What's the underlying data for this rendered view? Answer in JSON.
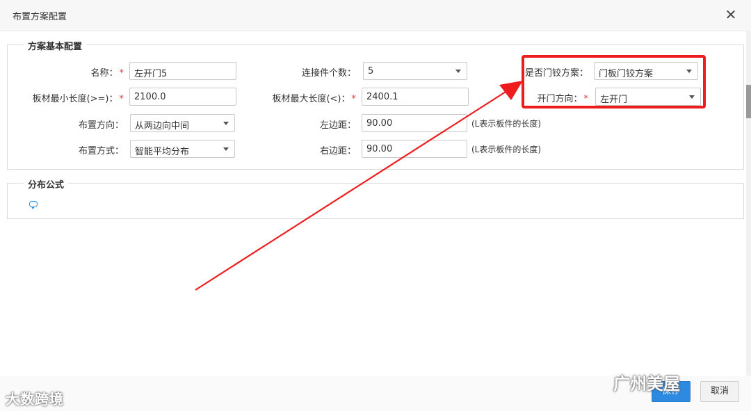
{
  "dialog": {
    "title": "布置方案配置",
    "close_glyph": "✕"
  },
  "basic": {
    "legend": "方案基本配置",
    "name": {
      "label": "名称：",
      "required": "*",
      "value": "左开门5"
    },
    "connector_count": {
      "label": "连接件个数：",
      "value": "5"
    },
    "is_hinge_plan": {
      "label": "是否门铰方案：",
      "value": "门板门铰方案"
    },
    "min_length": {
      "label": "板材最小长度(>=)：",
      "required": "*",
      "value": "2100.0"
    },
    "max_length": {
      "label": "板材最大长度(<)：",
      "required": "*",
      "value": "2400.1"
    },
    "door_direction": {
      "label": "开门方向：",
      "required": "*",
      "value": "左开门"
    },
    "layout_direction": {
      "label": "布置方向：",
      "value": "从两边向中间"
    },
    "left_margin": {
      "label": "左边距：",
      "value": "90.00",
      "hint": "(L表示板件的长度)"
    },
    "layout_method": {
      "label": "布置方式：",
      "value": "智能平均分布"
    },
    "right_margin": {
      "label": "右边距：",
      "value": "90.00",
      "hint": "(L表示板件的长度)"
    }
  },
  "formula": {
    "legend": "分布公式",
    "icon": "comment-icon"
  },
  "footer": {
    "save_label": "保存",
    "cancel_label": "取消"
  },
  "watermarks": {
    "left": "大数跨境",
    "right": "广州美屋"
  },
  "colors": {
    "highlight": "#ee1c1c",
    "primary": "#2d8ae0",
    "required": "#e4393c"
  }
}
